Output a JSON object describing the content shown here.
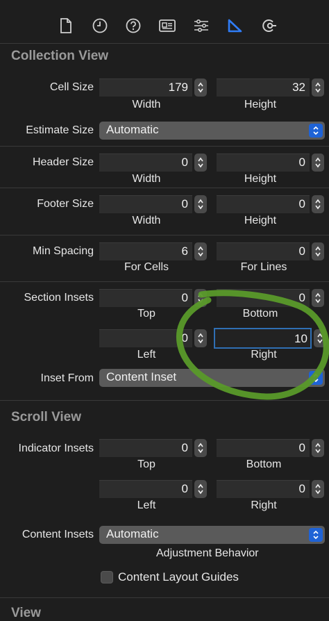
{
  "toolbar": {
    "icons": [
      "file-icon",
      "history-icon",
      "help-icon",
      "identity-icon",
      "attributes-icon",
      "size-ruler-icon",
      "connections-icon"
    ],
    "active_color": "#2f7cf6"
  },
  "collection_view": {
    "title": "Collection View",
    "cell_size": {
      "label": "Cell Size",
      "width": "179",
      "height": "32",
      "width_sub": "Width",
      "height_sub": "Height"
    },
    "estimate_size": {
      "label": "Estimate Size",
      "value": "Automatic"
    },
    "header_size": {
      "label": "Header Size",
      "width": "0",
      "height": "0",
      "width_sub": "Width",
      "height_sub": "Height"
    },
    "footer_size": {
      "label": "Footer Size",
      "width": "0",
      "height": "0",
      "width_sub": "Width",
      "height_sub": "Height"
    },
    "min_spacing": {
      "label": "Min Spacing",
      "cells": "6",
      "lines": "0",
      "cells_sub": "For Cells",
      "lines_sub": "For Lines"
    },
    "section_insets": {
      "label": "Section Insets",
      "top": "0",
      "bottom": "0",
      "left": "0",
      "right": "10",
      "top_sub": "Top",
      "bottom_sub": "Bottom",
      "left_sub": "Left",
      "right_sub": "Right"
    },
    "inset_from": {
      "label": "Inset From",
      "value": "Content Inset"
    }
  },
  "scroll_view": {
    "title": "Scroll View",
    "indicator_insets": {
      "label": "Indicator Insets",
      "top": "0",
      "bottom": "0",
      "left": "0",
      "right": "0",
      "top_sub": "Top",
      "bottom_sub": "Bottom",
      "left_sub": "Left",
      "right_sub": "Right"
    },
    "content_insets": {
      "label": "Content Insets",
      "value": "Automatic",
      "sub": "Adjustment Behavior"
    },
    "content_layout_guides": {
      "label": "Content Layout Guides",
      "checked": false
    }
  },
  "view": {
    "title": "View"
  },
  "annotation": {
    "color": "#5a9a2a"
  }
}
